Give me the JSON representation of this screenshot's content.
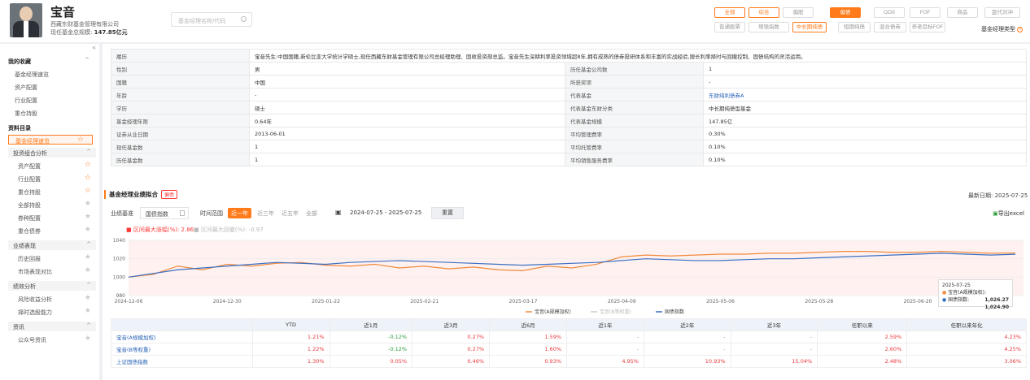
{
  "header": {
    "name": "宝音",
    "company": "西藏东财基金管理有限公司",
    "scale_label": "现任基金总规模:",
    "scale_value": "147.85亿元",
    "search_placeholder": "基金经理名称/代码",
    "tags_row1": [
      "全部",
      "综合",
      "偏股",
      "偏债",
      "QDII",
      "FOF",
      "商品",
      "盘代对冲"
    ],
    "tags_row2": [
      "普通股票",
      "增强指数",
      "中长期纯债",
      "短期纯债",
      "混合债券",
      "养老目标FOF"
    ],
    "fund_type_label": "基金经理类型"
  },
  "sidebar": {
    "my_favorites": "我的收藏",
    "fav_items": [
      "基金经理速览",
      "资产配置",
      "行业配置",
      "重仓持股"
    ],
    "catalog": "资料目录",
    "selected": "基金经理速览",
    "groups": [
      {
        "label": "投资组合分析",
        "items": [
          "资产配置",
          "行业配置",
          "重仓持股",
          "全部持股",
          "券种配置",
          "重仓债券"
        ]
      },
      {
        "label": "业绩表现",
        "items": [
          "历史回报",
          "市场表现对比"
        ]
      },
      {
        "label": "绩效分析",
        "items": [
          "风险收益分析",
          "择时选股能力"
        ]
      },
      {
        "label": "资讯",
        "items": [
          "公众号资讯"
        ]
      }
    ]
  },
  "profile": {
    "resume_label": "履历",
    "resume_text": "宝音先生:中国国籍,新伦比亚大学统计学硕士,现任西藏东财基金管理有限公司总经理助理、固收投资部总监。宝音先生深耕利率投资领域超8年,拥有成熟的债券投研体系和丰富的实战经验,擅长利率择时与回撤控制、固债结构的灵活运用。",
    "rows": [
      [
        "性别",
        "男",
        "历任基金公司数",
        "1"
      ],
      [
        "国籍",
        "中国",
        "所获奖项",
        "-"
      ],
      [
        "年龄",
        "-",
        "代表基金",
        "东财纯利债券A"
      ],
      [
        "学历",
        "硕士",
        "代表基金东财分类",
        "中长期纯债型基金"
      ],
      [
        "基金经理年限",
        "0.64年",
        "代表基金规模",
        "147.85亿"
      ],
      [
        "证券从业日期",
        "2013-06-01",
        "平均管理费率",
        "0.30%"
      ],
      [
        "现任基金数",
        "1",
        "平均托管费率",
        "0.10%"
      ],
      [
        "历任基金数",
        "1",
        "平均销售服务费率",
        "0.10%"
      ]
    ]
  },
  "perf": {
    "title": "基金经理业绩拟合",
    "badge": "偏债",
    "latest_label": "最新日期:",
    "latest_date": "2025-07-25",
    "bench_label": "业绩基准",
    "bench_value": "国债指数",
    "range_label": "时间范围",
    "ranges": [
      "近一年",
      "近三年",
      "近五年",
      "全部"
    ],
    "date_range": "2024-07-25  -  2025-07-25",
    "reset": "重置",
    "export": "导出excel",
    "dd1": "区间最大涨幅(%): 2.86",
    "dd2": "区间最大回撤(%): -0.97"
  },
  "chart_data": {
    "type": "line",
    "x_ticks": [
      "2024-12-06",
      "2024-12-30",
      "2025-01-22",
      "2025-02-21",
      "2025-03-17",
      "2025-04-09",
      "2025-05-06",
      "2025-05-28",
      "2025-06-20"
    ],
    "ylim": [
      980,
      1040
    ],
    "y_ticks": [
      980,
      1000,
      1020,
      1040
    ],
    "series": [
      {
        "name": "宝音(A规模加权)",
        "color": "#f08a3c",
        "values": [
          1000,
          1003,
          1012,
          1008,
          1014,
          1012,
          1015,
          1016,
          1013,
          1012,
          1014,
          1010,
          1012,
          1009,
          1011,
          1008,
          1007,
          1012,
          1010,
          1014,
          1022,
          1024,
          1023,
          1024,
          1025,
          1025,
          1026,
          1026,
          1027,
          1028,
          1028,
          1027,
          1027,
          1028,
          1027,
          1026,
          1026.27
        ]
      },
      {
        "name": "国债指数",
        "color": "#3a6fc4",
        "values": [
          1000,
          1004,
          1008,
          1010,
          1012,
          1014,
          1016,
          1015,
          1014,
          1016,
          1017,
          1018,
          1017,
          1016,
          1015,
          1014,
          1013,
          1014,
          1015,
          1016,
          1018,
          1020,
          1019,
          1018,
          1018,
          1019,
          1020,
          1020,
          1021,
          1022,
          1023,
          1024,
          1025,
          1026,
          1025,
          1024,
          1024.9
        ]
      }
    ],
    "legend": [
      "宝音(A规模加权)",
      "宝音(B等权重)",
      "国债指数"
    ],
    "tooltip": {
      "date": "2025-07-25",
      "a_label": "宝音(A规模加权):",
      "a_value": "1,026.27",
      "b_label": "国债指数:",
      "b_value": "1,024.90"
    }
  },
  "returns": {
    "headers": [
      "",
      "YTD",
      "近1月",
      "近3月",
      "近6月",
      "近1年",
      "近2年",
      "近3年",
      "任职以来",
      "任职以来年化"
    ],
    "rows": [
      [
        "宝音(A规模加权)",
        "1.21%",
        "-0.12%",
        "0.27%",
        "1.59%",
        "-",
        "-",
        "-",
        "2.59%",
        "4.23%"
      ],
      [
        "宝音(B等权重)",
        "1.22%",
        "-0.12%",
        "0.27%",
        "1.60%",
        "-",
        "-",
        "-",
        "2.60%",
        "4.25%"
      ],
      [
        "上证国债指数",
        "1.30%",
        "0.05%",
        "0.46%",
        "0.93%",
        "4.95%",
        "10.93%",
        "15.04%",
        "2.48%",
        "3.06%"
      ]
    ]
  }
}
